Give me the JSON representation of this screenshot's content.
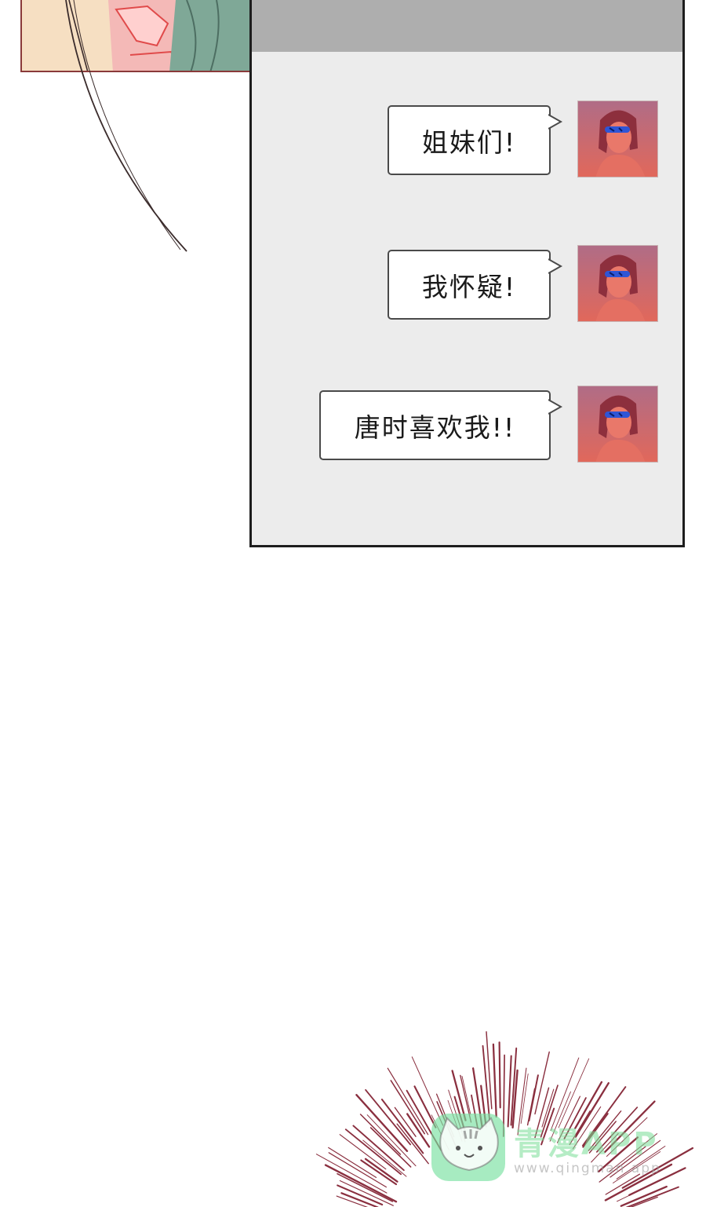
{
  "chat": {
    "messages": [
      {
        "text": "姐妹们!"
      },
      {
        "text": "我怀疑!"
      },
      {
        "text": "唐时喜欢我!!"
      }
    ]
  },
  "watermark": {
    "brand": "青漫APP",
    "url": "www.qingman.app"
  },
  "colors": {
    "phone_bg": "#ececec",
    "phone_header": "#aeaeae",
    "avatar_bg": "#d9685f",
    "censor_bar": "#2f55d6",
    "speed_lines": "#8a2f3f"
  }
}
